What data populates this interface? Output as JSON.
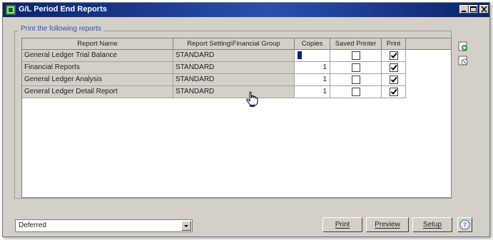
{
  "window": {
    "title": "G/L Period End Reports"
  },
  "group": {
    "legend": "Print the following reports"
  },
  "grid": {
    "columns": [
      "Report Name",
      "Report Setting\\Financial Group",
      "Copies",
      "Saved Printer",
      "Print"
    ],
    "rows": [
      {
        "name": "General Ledger Trial Balance",
        "setting": "STANDARD",
        "copies": "",
        "saved_printer": false,
        "print": true
      },
      {
        "name": "Financial Reports",
        "setting": "STANDARD",
        "copies": "1",
        "saved_printer": false,
        "print": true
      },
      {
        "name": "General Ledger Analysis",
        "setting": "STANDARD",
        "copies": "1",
        "saved_printer": false,
        "print": true
      },
      {
        "name": "General Ledger Detail Report",
        "setting": "STANDARD",
        "copies": "1",
        "saved_printer": false,
        "print": true
      }
    ]
  },
  "footer": {
    "output_select": "Deferred",
    "print_label": "Print",
    "preview_label": "Preview",
    "setup_label": "Setup"
  },
  "colors": {
    "titlebar": "#0a246a",
    "face": "#d4d0c8",
    "legend": "#3050a8"
  }
}
